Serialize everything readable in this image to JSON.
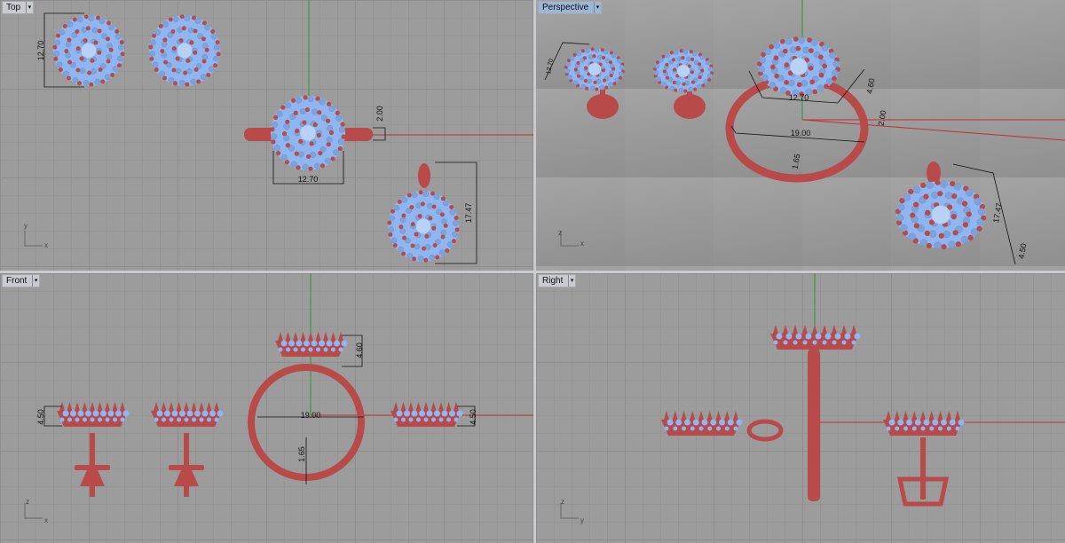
{
  "viewports": {
    "top": {
      "label": "Top",
      "axis_v": "y",
      "axis_h": "x",
      "dims": [
        "12.70",
        "2.00",
        "12.70",
        "17.47"
      ]
    },
    "perspective": {
      "label": "Perspective",
      "axis_v": "z",
      "axis_h": "x",
      "dims": [
        "12.70",
        "4.60",
        "12.70",
        "2.00",
        "19.00",
        "1.65",
        "17.47",
        "4.50"
      ]
    },
    "front": {
      "label": "Front",
      "axis_v": "z",
      "axis_h": "x",
      "dims": [
        "4.50",
        "4.60",
        "19.00",
        "1.65",
        "4.50"
      ]
    },
    "right": {
      "label": "Right",
      "axis_v": "z",
      "axis_h": "y",
      "dims": []
    }
  },
  "menu_arrow": "▾",
  "colors": {
    "metal": "#b84a4a",
    "gem": "#8fb6f0",
    "x_axis": "#c03030",
    "y_axis": "#2a9a2a",
    "active_tab": "#9cb6d8"
  }
}
